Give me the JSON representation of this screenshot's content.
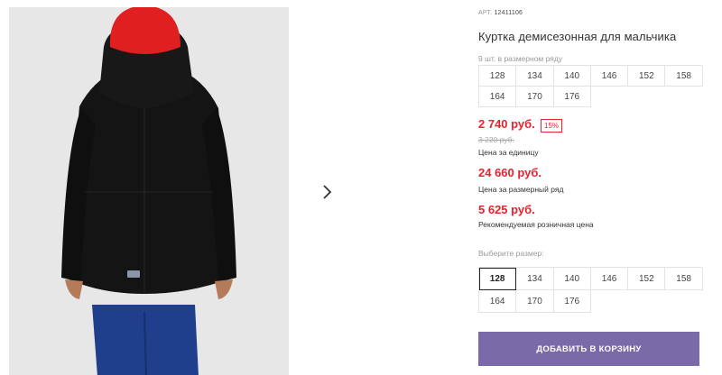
{
  "product": {
    "article_label": "АРТ.",
    "article_number": "12411106",
    "title": "Куртка демисезонная для мальчика",
    "pack_note": "9 шт. в размерном ряду",
    "pack_sizes": [
      "128",
      "134",
      "140",
      "146",
      "152",
      "158",
      "164",
      "170",
      "176"
    ]
  },
  "prices": {
    "unit_price": "2 740 руб.",
    "discount": "15%",
    "old_price": "3 220 руб.",
    "unit_label": "Цена за единицу",
    "pack_price": "24 660 руб.",
    "pack_label": "Цена за размерный ряд",
    "rrp_price": "5 625 руб.",
    "rrp_label": "Рекомендуемая розничная цена"
  },
  "size_select": {
    "label": "Выберите размер:",
    "selected": "128",
    "sizes": [
      "128",
      "134",
      "140",
      "146",
      "152",
      "158",
      "164",
      "170",
      "176"
    ]
  },
  "actions": {
    "add_to_cart": "ДОБАВИТЬ В КОРЗИНУ",
    "next_icon": "chevron-right-icon"
  },
  "colors": {
    "price_red": "#e8222f",
    "button_purple": "#7a6aa8"
  }
}
